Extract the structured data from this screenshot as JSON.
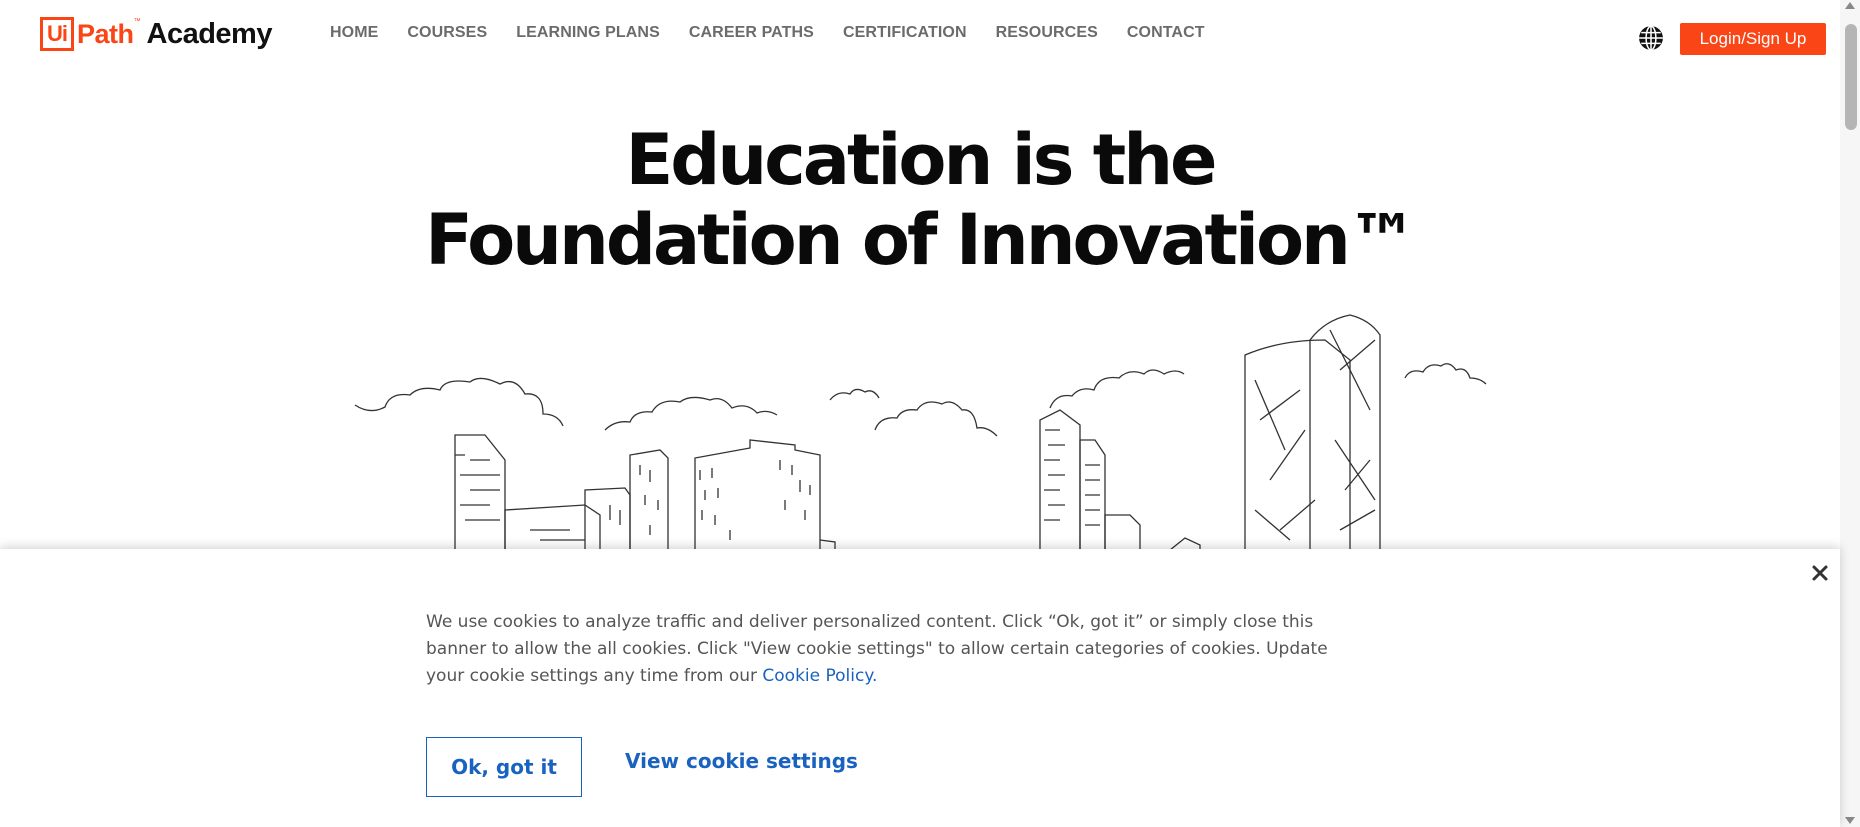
{
  "logo": {
    "ui": "Ui",
    "path": "Path",
    "tm": "™",
    "academy": "Academy"
  },
  "nav": {
    "items": [
      {
        "label": "HOME"
      },
      {
        "label": "COURSES"
      },
      {
        "label": "LEARNING PLANS"
      },
      {
        "label": "CAREER PATHS"
      },
      {
        "label": "CERTIFICATION"
      },
      {
        "label": "RESOURCES"
      },
      {
        "label": "CONTACT"
      }
    ],
    "globe_icon": "globe-icon",
    "login_label": "Login/Sign Up"
  },
  "hero": {
    "title_line1": "Education is the",
    "title_line2": "Foundation of Innovation™"
  },
  "cookie": {
    "text": "We use cookies to analyze traffic and deliver personalized content. Click “Ok, got it” or simply close this banner to allow the all cookies. Click \"View cookie settings\" to allow certain categories of cookies. Update your cookie settings any time from our ",
    "policy_link": "Cookie Policy",
    "period": ".",
    "ok_label": "Ok, got it",
    "settings_label": "View cookie settings",
    "close_icon": "close-icon"
  },
  "colors": {
    "brand": "#fa4616",
    "link": "#1a62c0",
    "nav_text": "#6b6b6b"
  }
}
